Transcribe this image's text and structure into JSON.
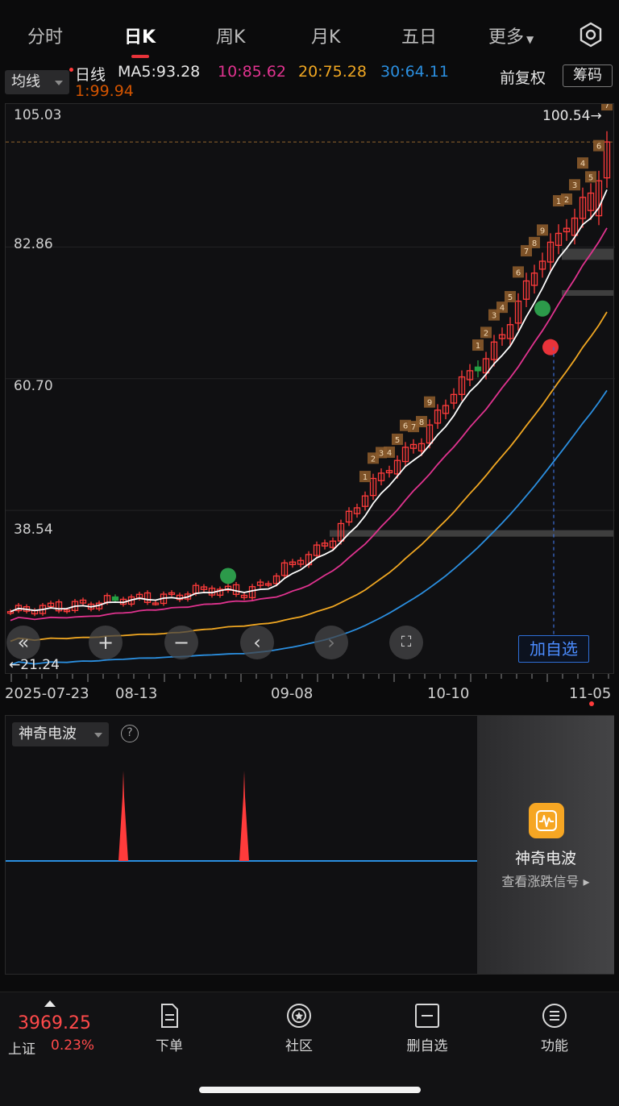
{
  "tabs": [
    "分时",
    "日K",
    "周K",
    "月K",
    "五日",
    "更多"
  ],
  "active_tab": "日K",
  "indicator_header": {
    "ma_select": "均线",
    "period_label": "日线",
    "ma5": "MA5:93.28",
    "ma10": "10:85.62",
    "ma20": "20:75.28",
    "ma30": "30:64.11",
    "ma1": "1:99.94",
    "adjust": "前复权",
    "chips_button": "筹码"
  },
  "colors": {
    "up": "#ff3b3b",
    "down": "#25a244",
    "ma5": "#ffffff",
    "ma10": "#e0338f",
    "ma20": "#f0a722",
    "ma30": "#2b8fe0",
    "ma1": "#d35400",
    "accent": "#2f6fd8"
  },
  "chart_data": {
    "type": "candlestick",
    "y_ticks": [
      "105.03",
      "82.86",
      "60.70",
      "38.54"
    ],
    "max_label": "100.54",
    "min_label": "21.24",
    "x_labels": [
      "2025-07-23",
      "08-13",
      "09-08",
      "10-10",
      "11-05"
    ],
    "ylim": [
      16.3,
      105.03
    ],
    "series": [
      {
        "name": "MA5",
        "last": 93.28
      },
      {
        "name": "MA10",
        "last": 85.62
      },
      {
        "name": "MA20",
        "last": 75.28
      },
      {
        "name": "MA30",
        "last": 64.11
      }
    ]
  },
  "controls": {
    "add_watch": "加自选"
  },
  "lower_panel": {
    "indicator": "神奇电波",
    "promo_title": "神奇电波",
    "promo_sub": "查看涨跌信号"
  },
  "bottom_bar": {
    "index_value": "3969.25",
    "index_name": "上证",
    "index_change": "0.23%",
    "items": [
      "下单",
      "社区",
      "删自选",
      "功能"
    ]
  }
}
